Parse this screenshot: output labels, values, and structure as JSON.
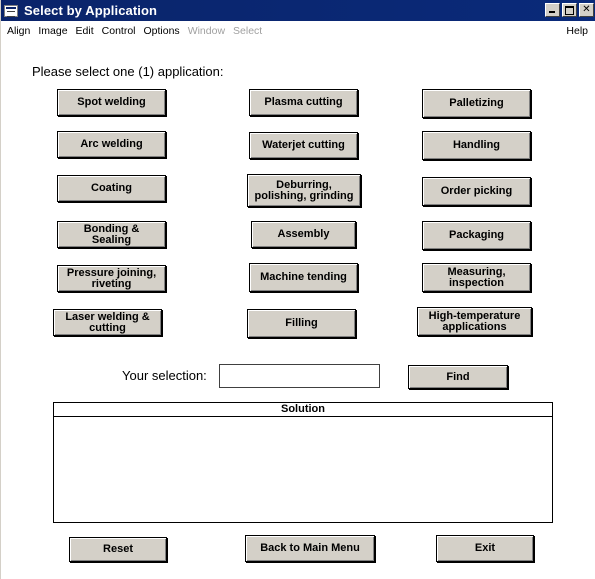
{
  "window": {
    "title": "Select by Application"
  },
  "menu": {
    "items": [
      {
        "label": "Align",
        "enabled": true
      },
      {
        "label": "Image",
        "enabled": true
      },
      {
        "label": "Edit",
        "enabled": true
      },
      {
        "label": "Control",
        "enabled": true
      },
      {
        "label": "Options",
        "enabled": true
      },
      {
        "label": "Window",
        "enabled": false
      },
      {
        "label": "Select",
        "enabled": false
      }
    ],
    "help": "Help"
  },
  "prompt": "Please select one (1) application:",
  "applications": {
    "spot_welding": "Spot welding",
    "plasma_cutting": "Plasma cutting",
    "palletizing": "Palletizing",
    "arc_welding": "Arc welding",
    "waterjet_cutting": "Waterjet cutting",
    "handling": "Handling",
    "coating": "Coating",
    "deburring_l1": "Deburring,",
    "deburring_l2": "polishing, grinding",
    "order_picking": "Order picking",
    "bonding_l1": "Bonding &",
    "bonding_l2": "Sealing",
    "assembly": "Assembly",
    "packaging": "Packaging",
    "pressure_l1": "Pressure joining,",
    "pressure_l2": "riveting",
    "machine_tending": "Machine tending",
    "measuring_l1": "Measuring,",
    "measuring_l2": "inspection",
    "laser_l1": "Laser welding &",
    "laser_l2": "cutting",
    "filling": "Filling",
    "hightemp_l1": "High-temperature",
    "hightemp_l2": "applications"
  },
  "selection": {
    "label": "Your selection:",
    "value": "",
    "find_label": "Find"
  },
  "solution": {
    "header": "Solution"
  },
  "footer": {
    "reset": "Reset",
    "back": "Back to Main Menu",
    "exit": "Exit"
  },
  "colors": {
    "titlebar": "#0a246a",
    "button_face": "#d4d0c8"
  }
}
